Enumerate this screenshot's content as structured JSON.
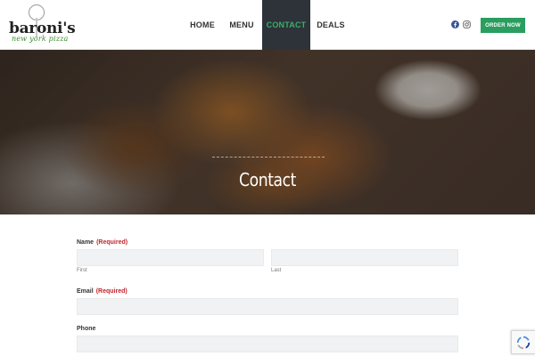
{
  "header": {
    "logo": {
      "word": "baroni's",
      "tagline": "new york pizza"
    },
    "nav": [
      {
        "label": "HOME"
      },
      {
        "label": "MENU"
      },
      {
        "label": "CONTACT"
      },
      {
        "label": "DEALS"
      }
    ],
    "social_icons": [
      "facebook-icon",
      "instagram-icon"
    ],
    "order_button": "ORDER NOW",
    "colors": {
      "accent_green": "#2a9e5f",
      "active_nav_bg": "#2d3339",
      "active_nav_text": "#3aae6c"
    }
  },
  "hero": {
    "title": "Contact"
  },
  "form": {
    "name": {
      "label": "Name",
      "required": "(Required)",
      "first_sub": "First",
      "last_sub": "Last",
      "first_value": "",
      "last_value": ""
    },
    "email": {
      "label": "Email",
      "required": "(Required)",
      "value": ""
    },
    "phone": {
      "label": "Phone",
      "value": ""
    },
    "required_color": "#c0262d"
  },
  "recaptcha": {
    "icon": "recaptcha-icon"
  }
}
